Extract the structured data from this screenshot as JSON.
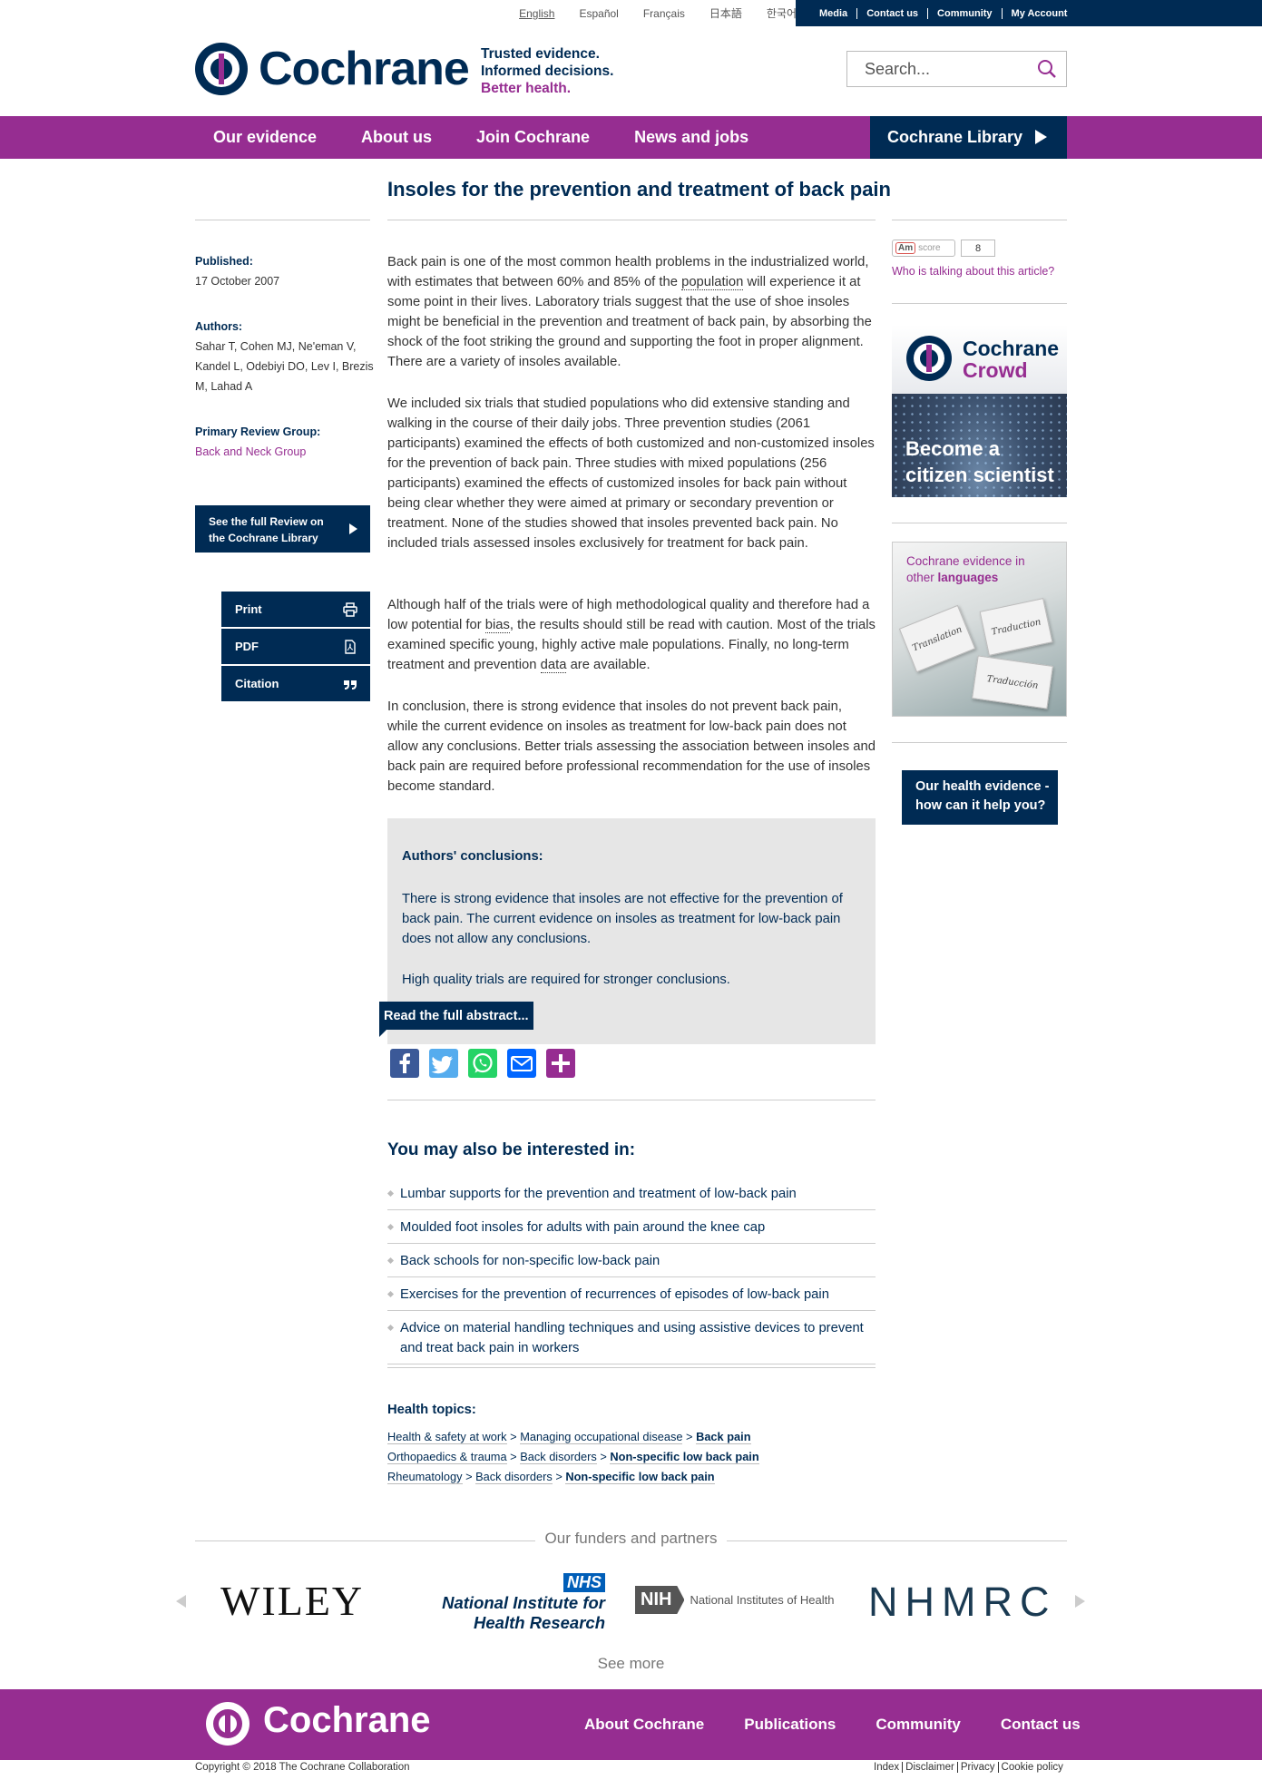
{
  "topbar": {
    "languages": [
      "English",
      "Español",
      "Français",
      "日本語",
      "한국어"
    ],
    "utility": [
      "Media",
      "Contact us",
      "Community",
      "My Account"
    ]
  },
  "header": {
    "logo_text": "Cochrane",
    "tagline": [
      "Trusted evidence.",
      "Informed decisions.",
      "Better health."
    ],
    "search_placeholder": "Search..."
  },
  "nav": {
    "items": [
      "Our evidence",
      "About us",
      "Join Cochrane",
      "News and jobs"
    ],
    "library": "Cochrane Library"
  },
  "article": {
    "title": "Insoles for the prevention and treatment of back pain",
    "published_label": "Published:",
    "published": "17 October 2007",
    "authors_label": "Authors:",
    "authors": [
      "Sahar T, Cohen MJ, Ne'eman V,",
      "Kandel L, Odebiyi DO, Lev I, Brezis",
      "M, Lahad A"
    ],
    "group_label": "Primary Review Group:",
    "group": "Back and Neck Group",
    "full_review": [
      "See the full Review on",
      "the Cochrane Library"
    ],
    "tools": [
      "Print",
      "PDF",
      "Citation"
    ],
    "p1": {
      "a": "Back pain is one of the most common health problems in the industrialized world, with estimates that between 60% and 85% of the ",
      "link": "population",
      "b": " will experience it at some point in their lives. Laboratory trials suggest that the use of shoe insoles might be beneficial in the prevention and treatment of back pain, by absorbing the shock of the foot striking the ground and supporting the foot in proper alignment. There are a variety of insoles available."
    },
    "p2": "We included six trials that studied populations who did extensive standing and walking in the course of their daily jobs. Three prevention studies (2061 participants) examined the effects of both customized and non-customized insoles for the prevention of back pain. Three studies with mixed populations (256 participants) examined the effects of customized insoles for back pain without being clear whether they were aimed at primary or secondary prevention or treatment. None of the studies showed that insoles prevented back pain. No included trials assessed insoles exclusively for treatment for back pain.",
    "p3": {
      "a": "Although half of the trials were of high methodological quality and therefore had a low potential for ",
      "link1": "bias",
      "b": ", the results should still be read with caution. Most of the trials examined specific young, highly active male populations. Finally, no long-term treatment and prevention ",
      "link2": "data",
      "c": " are available."
    },
    "p4": "In conclusion, there is strong evidence that insoles do not prevent back pain, while the current evidence on insoles as treatment for low-back pain does not allow any conclusions. Better trials assessing the association between insoles and back pain are required before professional recommendation for the use of insoles become standard.",
    "conclusions_heading": "Authors' conclusions:",
    "conclusions_p1": "There is strong evidence that insoles are not effective for the prevention of back pain. The current evidence on insoles as treatment for low-back pain does not allow any conclusions.",
    "conclusions_p2": "High quality trials are required for stronger conclusions.",
    "read_abstract": "Read the full abstract..."
  },
  "share": [
    {
      "name": "facebook",
      "glyph": "f",
      "color": "#3b5998"
    },
    {
      "name": "twitter",
      "glyph": "t",
      "color": "#55acee"
    },
    {
      "name": "whatsapp",
      "glyph": "w",
      "color": "#25d366"
    },
    {
      "name": "email",
      "glyph": "e",
      "color": "#0166ff"
    },
    {
      "name": "more",
      "glyph": "+",
      "color": "#962d91"
    }
  ],
  "related": {
    "heading": "You may also be interested in:",
    "items": [
      "Lumbar supports for the prevention and treatment of low-back pain",
      "Moulded foot insoles for adults with pain around the knee cap",
      "Back schools for non-specific low-back pain",
      "Exercises for the prevention of recurrences of episodes of low-back pain",
      "Advice on material handling techniques and using assistive devices to prevent and treat back pain in workers"
    ]
  },
  "topics": {
    "heading": "Health topics:",
    "lines": [
      {
        "a": "Health & safety at work",
        "b": "Managing occupational disease",
        "c": "Back pain"
      },
      {
        "a": "Orthopaedics & trauma",
        "b": "Back disorders",
        "c": "Non-specific low back pain"
      },
      {
        "a": "Rheumatology",
        "b": "Back disorders",
        "c": "Non-specific low back pain"
      }
    ]
  },
  "sidebar": {
    "altmetric_am": "Am",
    "altmetric_score": "score",
    "altmetric_count": "8",
    "who_talking": "Who is talking about this article?",
    "crowd_title1": "Cochrane",
    "crowd_title2": "Crowd",
    "crowd_tag": [
      "Become a",
      "citizen scientist"
    ],
    "lang_text1": "Cochrane evidence in",
    "lang_text2": "other ",
    "lang_text3": "languages",
    "puzzle_words": [
      "Translation",
      "Traduction",
      "Traducción"
    ],
    "health_evidence": [
      "Our health evidence -",
      "how can it help you?"
    ]
  },
  "funders": {
    "heading": "Our funders and partners",
    "wiley": "WILEY",
    "nhs": "NHS",
    "nihr": [
      "National Institute for",
      "Health Research"
    ],
    "nih_mark": "NIH",
    "nih_text": "National Institutes of Health",
    "nhmrc": "NHMRC",
    "see_more": "See more"
  },
  "footer": {
    "logo_text": "Cochrane",
    "links": [
      "About Cochrane",
      "Publications",
      "Community",
      "Contact us"
    ],
    "copyright": "Copyright © 2018 The Cochrane Collaboration",
    "legal": [
      "Index",
      "Disclaimer",
      "Privacy",
      "Cookie policy"
    ]
  },
  "colors": {
    "navy": "#002b54",
    "purple": "#962d91"
  }
}
